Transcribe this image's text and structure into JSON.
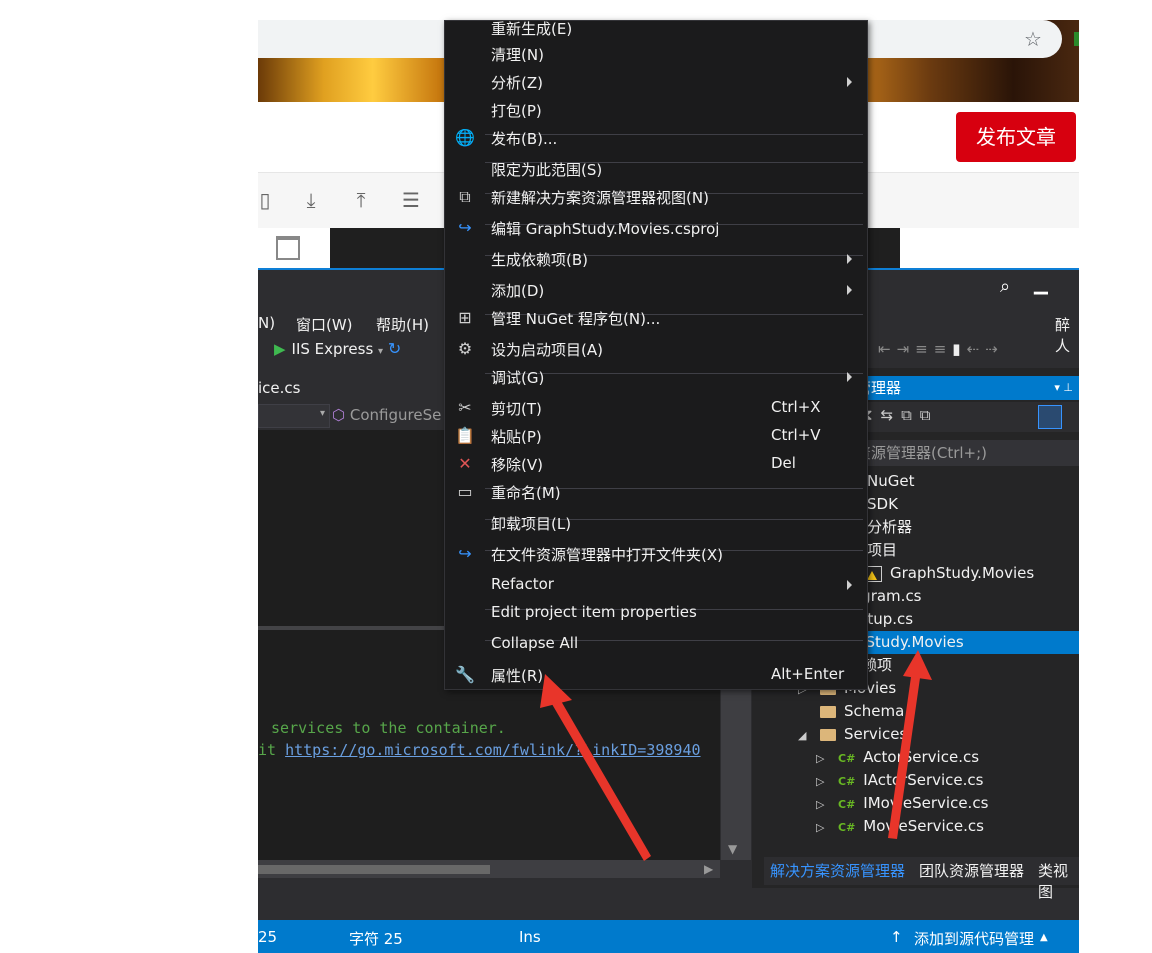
{
  "browser": {
    "publish_button": "发布文章"
  },
  "vs": {
    "menus": [
      "N)",
      "窗口(W)",
      "帮助(H)"
    ],
    "run_target": "IIS Express",
    "doc_tab": "ice.cs",
    "nav_method": "ConfigureSe",
    "code_line1": " services to the container.",
    "code_line2_prefix": "it ",
    "code_link": "https://go.microsoft.com/fwlink/?LinkID=398940",
    "right_menu_label": "醉人"
  },
  "context_menu": {
    "items": [
      {
        "label": "重新生成(E)",
        "icon": "none"
      },
      {
        "label": "清理(N)",
        "icon": "none"
      },
      {
        "label": "分析(Z)",
        "icon": "none",
        "submenu": true
      },
      {
        "label": "打包(P)",
        "icon": "none"
      },
      {
        "label": "发布(B)...",
        "icon": "globe-icon"
      },
      {
        "label": "限定为此范围(S)",
        "icon": "none"
      },
      {
        "label": "新建解决方案资源管理器视图(N)",
        "icon": "new-view-icon"
      },
      {
        "label": "编辑 GraphStudy.Movies.csproj",
        "icon": "edit-arrow-icon"
      },
      {
        "label": "生成依赖项(B)",
        "icon": "none",
        "submenu": true
      },
      {
        "label": "添加(D)",
        "icon": "none",
        "submenu": true
      },
      {
        "label": "管理 NuGet 程序包(N)...",
        "icon": "nuget-icon"
      },
      {
        "label": "设为启动项目(A)",
        "icon": "gear-icon"
      },
      {
        "label": "调试(G)",
        "icon": "none",
        "submenu": true
      },
      {
        "label": "剪切(T)",
        "icon": "scissors-icon",
        "shortcut": "Ctrl+X"
      },
      {
        "label": "粘贴(P)",
        "icon": "paste-icon",
        "shortcut": "Ctrl+V"
      },
      {
        "label": "移除(V)",
        "icon": "remove-icon",
        "shortcut": "Del"
      },
      {
        "label": "重命名(M)",
        "icon": "rename-icon"
      },
      {
        "label": "卸载项目(L)",
        "icon": "none"
      },
      {
        "label": "在文件资源管理器中打开文件夹(X)",
        "icon": "open-folder-arrow-icon"
      },
      {
        "label": "Refactor",
        "icon": "none",
        "submenu": true
      },
      {
        "label": "Edit project item properties",
        "icon": "none"
      },
      {
        "label": "Collapse All",
        "icon": "none"
      },
      {
        "label": "属性(R)",
        "icon": "wrench-icon",
        "shortcut": "Alt+Enter"
      }
    ]
  },
  "solution_explorer": {
    "header": "管理器",
    "search_placeholder": "资源管理器(Ctrl+;)",
    "rows": [
      {
        "label": "NuGet",
        "kind": "text"
      },
      {
        "label": "SDK",
        "kind": "text"
      },
      {
        "label": "分析器",
        "kind": "text"
      },
      {
        "label": "项目",
        "kind": "text"
      },
      {
        "label": "GraphStudy.Movies",
        "kind": "project"
      },
      {
        "label": "ogram.cs",
        "kind": "text"
      },
      {
        "label": "artup.cs",
        "kind": "text"
      },
      {
        "label": "nStudy.Movies",
        "kind": "selected"
      },
      {
        "label": "赖项",
        "kind": "text"
      },
      {
        "label": "Movies",
        "kind": "folder"
      },
      {
        "label": "Schema",
        "kind": "folder"
      },
      {
        "label": "Services",
        "kind": "folder-open"
      },
      {
        "label": "ActorService.cs",
        "kind": "cs"
      },
      {
        "label": "IActorService.cs",
        "kind": "cs"
      },
      {
        "label": "IMovieService.cs",
        "kind": "cs"
      },
      {
        "label": "MovieService.cs",
        "kind": "cs"
      }
    ],
    "tabs": [
      "解决方案资源管理器",
      "团队资源管理器",
      "类视图"
    ]
  },
  "status_bar": {
    "col": "25",
    "chars": "字符 25",
    "mode": "Ins",
    "source_control": "添加到源代码管理"
  },
  "colors": {
    "accent": "#007acc",
    "publish_red": "#d7000f",
    "arrow_red": "#e8352a"
  }
}
